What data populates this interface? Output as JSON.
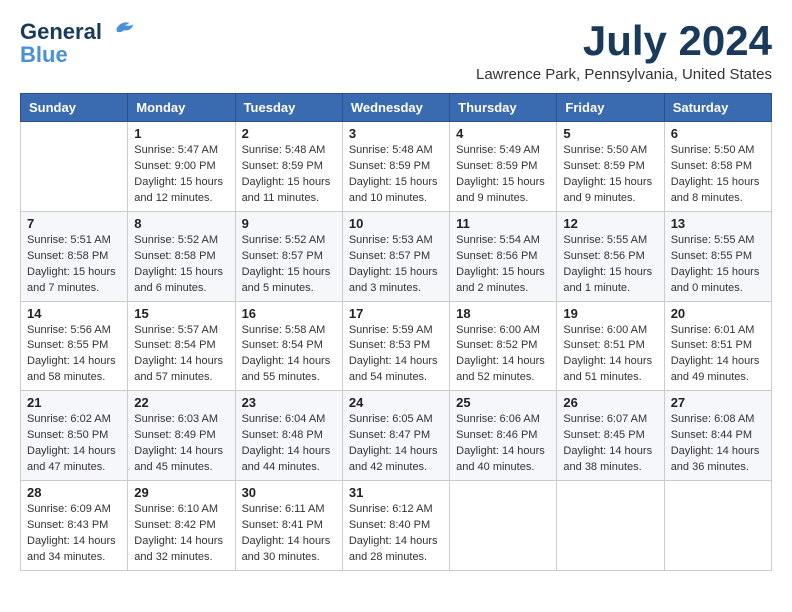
{
  "logo": {
    "line1": "General",
    "line2": "Blue"
  },
  "title": "July 2024",
  "location": "Lawrence Park, Pennsylvania, United States",
  "days_header": [
    "Sunday",
    "Monday",
    "Tuesday",
    "Wednesday",
    "Thursday",
    "Friday",
    "Saturday"
  ],
  "weeks": [
    [
      {
        "day": "",
        "info": ""
      },
      {
        "day": "1",
        "info": "Sunrise: 5:47 AM\nSunset: 9:00 PM\nDaylight: 15 hours\nand 12 minutes."
      },
      {
        "day": "2",
        "info": "Sunrise: 5:48 AM\nSunset: 8:59 PM\nDaylight: 15 hours\nand 11 minutes."
      },
      {
        "day": "3",
        "info": "Sunrise: 5:48 AM\nSunset: 8:59 PM\nDaylight: 15 hours\nand 10 minutes."
      },
      {
        "day": "4",
        "info": "Sunrise: 5:49 AM\nSunset: 8:59 PM\nDaylight: 15 hours\nand 9 minutes."
      },
      {
        "day": "5",
        "info": "Sunrise: 5:50 AM\nSunset: 8:59 PM\nDaylight: 15 hours\nand 9 minutes."
      },
      {
        "day": "6",
        "info": "Sunrise: 5:50 AM\nSunset: 8:58 PM\nDaylight: 15 hours\nand 8 minutes."
      }
    ],
    [
      {
        "day": "7",
        "info": "Sunrise: 5:51 AM\nSunset: 8:58 PM\nDaylight: 15 hours\nand 7 minutes."
      },
      {
        "day": "8",
        "info": "Sunrise: 5:52 AM\nSunset: 8:58 PM\nDaylight: 15 hours\nand 6 minutes."
      },
      {
        "day": "9",
        "info": "Sunrise: 5:52 AM\nSunset: 8:57 PM\nDaylight: 15 hours\nand 5 minutes."
      },
      {
        "day": "10",
        "info": "Sunrise: 5:53 AM\nSunset: 8:57 PM\nDaylight: 15 hours\nand 3 minutes."
      },
      {
        "day": "11",
        "info": "Sunrise: 5:54 AM\nSunset: 8:56 PM\nDaylight: 15 hours\nand 2 minutes."
      },
      {
        "day": "12",
        "info": "Sunrise: 5:55 AM\nSunset: 8:56 PM\nDaylight: 15 hours\nand 1 minute."
      },
      {
        "day": "13",
        "info": "Sunrise: 5:55 AM\nSunset: 8:55 PM\nDaylight: 15 hours\nand 0 minutes."
      }
    ],
    [
      {
        "day": "14",
        "info": "Sunrise: 5:56 AM\nSunset: 8:55 PM\nDaylight: 14 hours\nand 58 minutes."
      },
      {
        "day": "15",
        "info": "Sunrise: 5:57 AM\nSunset: 8:54 PM\nDaylight: 14 hours\nand 57 minutes."
      },
      {
        "day": "16",
        "info": "Sunrise: 5:58 AM\nSunset: 8:54 PM\nDaylight: 14 hours\nand 55 minutes."
      },
      {
        "day": "17",
        "info": "Sunrise: 5:59 AM\nSunset: 8:53 PM\nDaylight: 14 hours\nand 54 minutes."
      },
      {
        "day": "18",
        "info": "Sunrise: 6:00 AM\nSunset: 8:52 PM\nDaylight: 14 hours\nand 52 minutes."
      },
      {
        "day": "19",
        "info": "Sunrise: 6:00 AM\nSunset: 8:51 PM\nDaylight: 14 hours\nand 51 minutes."
      },
      {
        "day": "20",
        "info": "Sunrise: 6:01 AM\nSunset: 8:51 PM\nDaylight: 14 hours\nand 49 minutes."
      }
    ],
    [
      {
        "day": "21",
        "info": "Sunrise: 6:02 AM\nSunset: 8:50 PM\nDaylight: 14 hours\nand 47 minutes."
      },
      {
        "day": "22",
        "info": "Sunrise: 6:03 AM\nSunset: 8:49 PM\nDaylight: 14 hours\nand 45 minutes."
      },
      {
        "day": "23",
        "info": "Sunrise: 6:04 AM\nSunset: 8:48 PM\nDaylight: 14 hours\nand 44 minutes."
      },
      {
        "day": "24",
        "info": "Sunrise: 6:05 AM\nSunset: 8:47 PM\nDaylight: 14 hours\nand 42 minutes."
      },
      {
        "day": "25",
        "info": "Sunrise: 6:06 AM\nSunset: 8:46 PM\nDaylight: 14 hours\nand 40 minutes."
      },
      {
        "day": "26",
        "info": "Sunrise: 6:07 AM\nSunset: 8:45 PM\nDaylight: 14 hours\nand 38 minutes."
      },
      {
        "day": "27",
        "info": "Sunrise: 6:08 AM\nSunset: 8:44 PM\nDaylight: 14 hours\nand 36 minutes."
      }
    ],
    [
      {
        "day": "28",
        "info": "Sunrise: 6:09 AM\nSunset: 8:43 PM\nDaylight: 14 hours\nand 34 minutes."
      },
      {
        "day": "29",
        "info": "Sunrise: 6:10 AM\nSunset: 8:42 PM\nDaylight: 14 hours\nand 32 minutes."
      },
      {
        "day": "30",
        "info": "Sunrise: 6:11 AM\nSunset: 8:41 PM\nDaylight: 14 hours\nand 30 minutes."
      },
      {
        "day": "31",
        "info": "Sunrise: 6:12 AM\nSunset: 8:40 PM\nDaylight: 14 hours\nand 28 minutes."
      },
      {
        "day": "",
        "info": ""
      },
      {
        "day": "",
        "info": ""
      },
      {
        "day": "",
        "info": ""
      }
    ]
  ]
}
